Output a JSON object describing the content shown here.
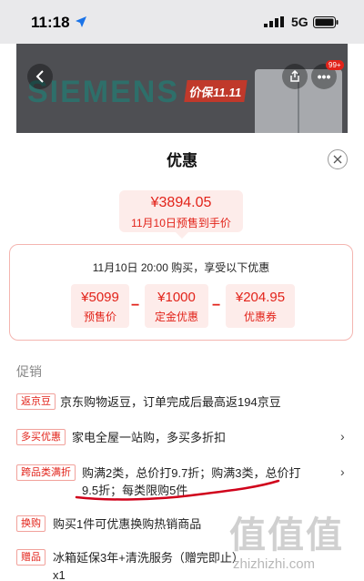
{
  "status_bar": {
    "time": "11:18",
    "network": "5G"
  },
  "background": {
    "brand": "SIEMENS",
    "sale_logo": "价保11.11",
    "cart_badge": "99+"
  },
  "sheet": {
    "title": "优惠",
    "final_price": "¥3894.05",
    "final_note": "11月10日预售到手价",
    "calc_desc": "11月10日 20:00 购买，享受以下优惠",
    "items": [
      {
        "value": "¥5099",
        "label": "预售价"
      },
      {
        "value": "¥1000",
        "label": "定金优惠"
      },
      {
        "value": "¥204.95",
        "label": "优惠券"
      }
    ],
    "operators": [
      "−",
      "−"
    ],
    "section_label": "促销",
    "promotions": [
      {
        "tag": "返京豆",
        "text": "京东购物返豆，订单完成后最高返194京豆",
        "has_chevron": false
      },
      {
        "tag": "多买优惠",
        "text": "家电全屋一站购，多买多折扣",
        "has_chevron": true
      },
      {
        "tag": "跨品类满折",
        "text_line1": "购满2类，总价打9.7折；购满3类，总价打",
        "text_line2": "9.5折；每类限购5件",
        "has_chevron": true
      },
      {
        "tag": "换购",
        "text": "购买1件可优惠换购热销商品",
        "has_chevron": false
      },
      {
        "tag": "赠品",
        "text": "冰箱延保3年+清洗服务（赠完即止）",
        "text_line2": "x1",
        "has_chevron": false
      }
    ],
    "chevron": "›"
  },
  "watermark": {
    "glyphs": "值值值",
    "url": "zhizhizhi.com"
  },
  "colors": {
    "accent": "#e2231a",
    "accent_bg": "#fdecea",
    "tag_border": "#f1a19b",
    "annotation": "#d0021b"
  }
}
